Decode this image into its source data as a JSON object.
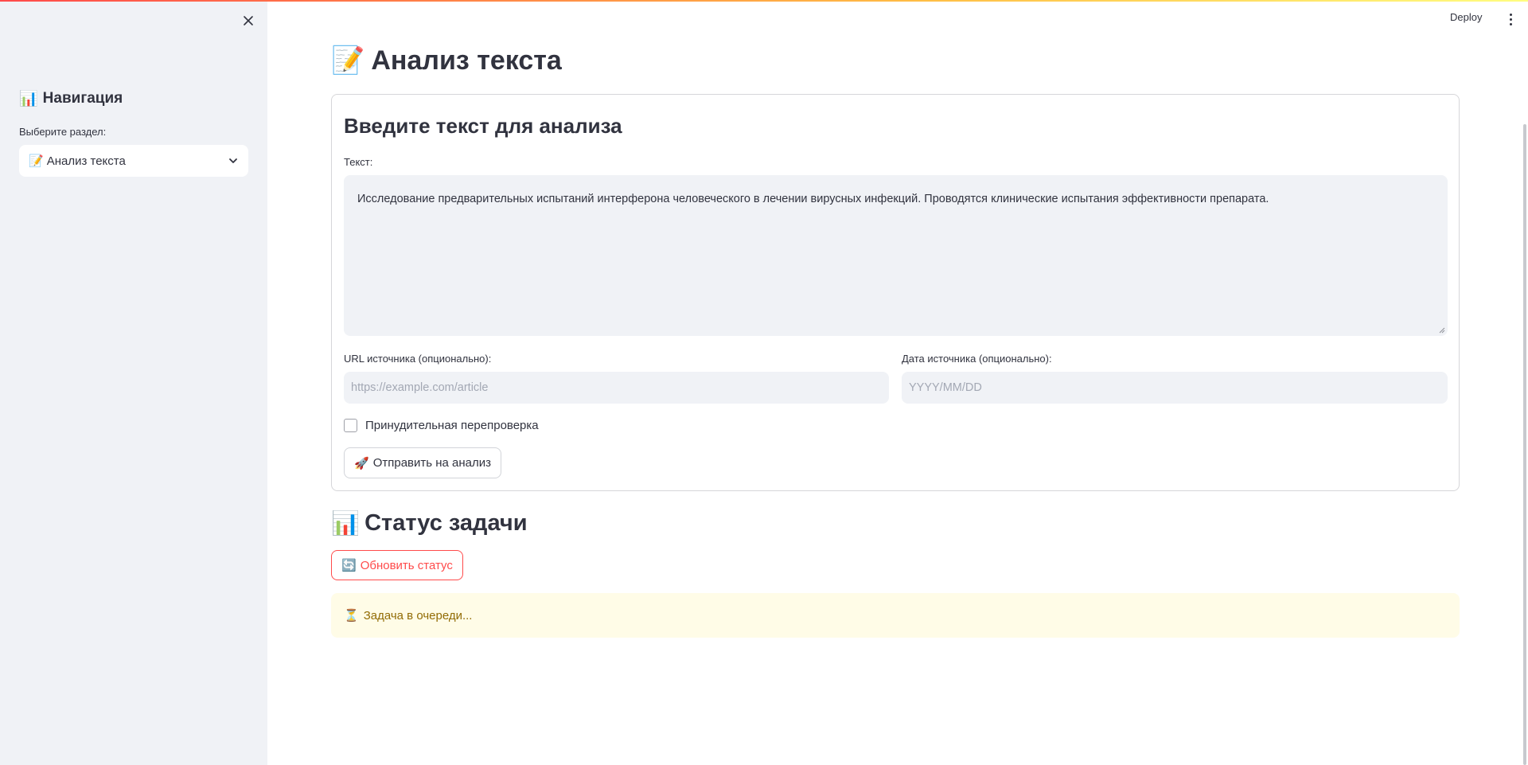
{
  "sidebar": {
    "title": "Навигация",
    "title_icon": "bar-chart-icon",
    "select_label": "Выберите раздел:",
    "select_value": "Анализ текста",
    "select_icon": "memo-icon"
  },
  "header": {
    "deploy_label": "Deploy"
  },
  "main": {
    "page_title": "Анализ текста",
    "page_title_icon": "memo-icon",
    "form": {
      "heading": "Введите текст для анализа",
      "text_label": "Текст:",
      "text_value": "Исследование предварительных испытаний интерферона человеческого в лечении вирусных инфекций. Проводятся клинические испытания эффективности препарата.",
      "url_label": "URL источника (опционально):",
      "url_placeholder": "https://example.com/article",
      "date_label": "Дата источника (опционально):",
      "date_placeholder": "YYYY/MM/DD",
      "force_recheck_label": "Принудительная перепроверка",
      "force_recheck_checked": false,
      "submit_label": "Отправить на анализ",
      "submit_icon": "rocket-icon"
    },
    "status": {
      "title": "Статус задачи",
      "title_icon": "bar-chart-icon",
      "refresh_label": "Обновить статус",
      "refresh_icon": "refresh-icon",
      "message": "Задача в очереди...",
      "message_icon": "hourglass-icon"
    }
  },
  "colors": {
    "accent": "#ff4b4b",
    "sidebar_bg": "#f0f2f6",
    "warning_bg": "#fffce7",
    "warning_text": "#926c05"
  }
}
